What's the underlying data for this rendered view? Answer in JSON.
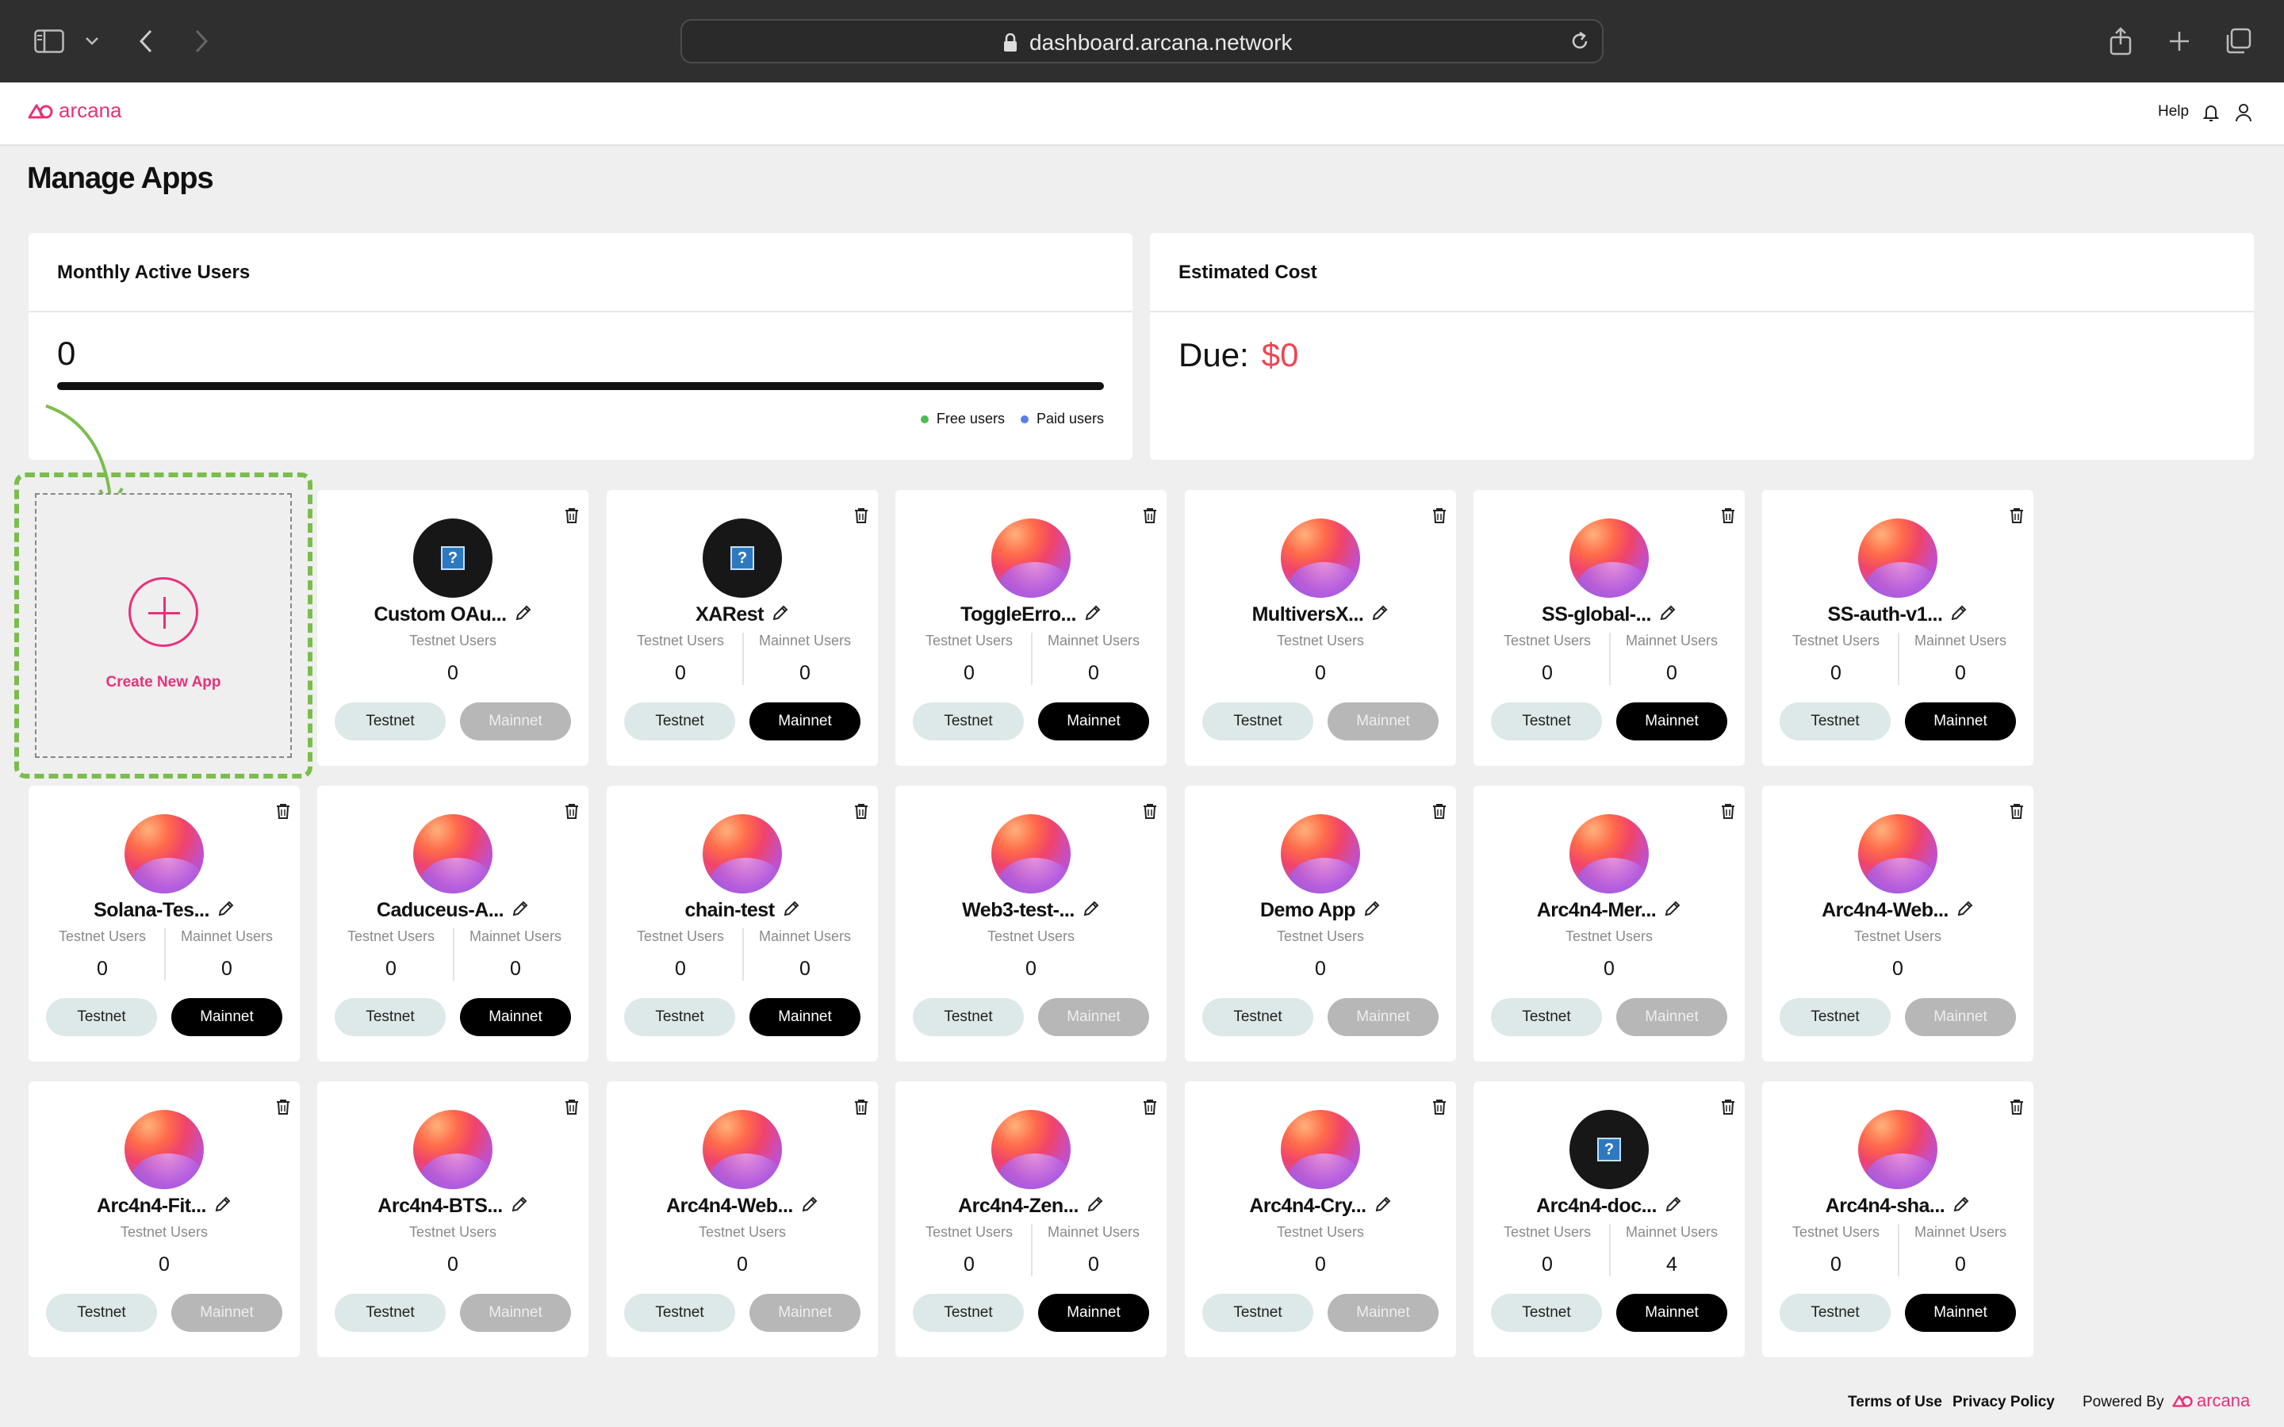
{
  "browser": {
    "url": "dashboard.arcana.network"
  },
  "header": {
    "logo_text": "arcana",
    "help": "Help"
  },
  "page_title": "Manage Apps",
  "mau": {
    "title": "Monthly Active Users",
    "value": "0",
    "legend_free": "Free users",
    "legend_paid": "Paid users",
    "free_color": "#4cbb5a",
    "paid_color": "#5b7de8"
  },
  "cost": {
    "title": "Estimated Cost",
    "due_label": "Due:",
    "due_value": "$0"
  },
  "create": {
    "label": "Create New App"
  },
  "labels": {
    "testnet_users": "Testnet Users",
    "mainnet_users": "Mainnet Users",
    "testnet": "Testnet",
    "mainnet": "Mainnet"
  },
  "apps": [
    {
      "name": "Custom OAu...",
      "avatar": "placeholder",
      "testnet": "0",
      "mainnet": null,
      "mainnet_active": false
    },
    {
      "name": "XARest",
      "avatar": "placeholder",
      "testnet": "0",
      "mainnet": "0",
      "mainnet_active": true
    },
    {
      "name": "ToggleErro...",
      "avatar": "gradient",
      "testnet": "0",
      "mainnet": "0",
      "mainnet_active": true
    },
    {
      "name": "MultiversX...",
      "avatar": "gradient",
      "testnet": "0",
      "mainnet": null,
      "mainnet_active": false
    },
    {
      "name": "SS-global-...",
      "avatar": "gradient",
      "testnet": "0",
      "mainnet": "0",
      "mainnet_active": true
    },
    {
      "name": "SS-auth-v1...",
      "avatar": "gradient",
      "testnet": "0",
      "mainnet": "0",
      "mainnet_active": true
    },
    {
      "name": "Solana-Tes...",
      "avatar": "gradient",
      "testnet": "0",
      "mainnet": "0",
      "mainnet_active": true
    },
    {
      "name": "Caduceus-A...",
      "avatar": "gradient",
      "testnet": "0",
      "mainnet": "0",
      "mainnet_active": true
    },
    {
      "name": "chain-test",
      "avatar": "gradient",
      "testnet": "0",
      "mainnet": "0",
      "mainnet_active": true
    },
    {
      "name": "Web3-test-...",
      "avatar": "gradient",
      "testnet": "0",
      "mainnet": null,
      "mainnet_active": false
    },
    {
      "name": "Demo App",
      "avatar": "gradient",
      "testnet": "0",
      "mainnet": null,
      "mainnet_active": false
    },
    {
      "name": "Arc4n4-Mer...",
      "avatar": "gradient",
      "testnet": "0",
      "mainnet": null,
      "mainnet_active": false
    },
    {
      "name": "Arc4n4-Web...",
      "avatar": "gradient",
      "testnet": "0",
      "mainnet": null,
      "mainnet_active": false
    },
    {
      "name": "Arc4n4-Fit...",
      "avatar": "gradient",
      "testnet": "0",
      "mainnet": null,
      "mainnet_active": false
    },
    {
      "name": "Arc4n4-BTS...",
      "avatar": "gradient",
      "testnet": "0",
      "mainnet": null,
      "mainnet_active": false
    },
    {
      "name": "Arc4n4-Web...",
      "avatar": "gradient",
      "testnet": "0",
      "mainnet": null,
      "mainnet_active": false
    },
    {
      "name": "Arc4n4-Zen...",
      "avatar": "gradient",
      "testnet": "0",
      "mainnet": "0",
      "mainnet_active": true
    },
    {
      "name": "Arc4n4-Cry...",
      "avatar": "gradient",
      "testnet": "0",
      "mainnet": null,
      "mainnet_active": false
    },
    {
      "name": "Arc4n4-doc...",
      "avatar": "placeholder",
      "testnet": "0",
      "mainnet": "4",
      "mainnet_active": true
    },
    {
      "name": "Arc4n4-sha...",
      "avatar": "gradient",
      "testnet": "0",
      "mainnet": "0",
      "mainnet_active": true
    }
  ],
  "footer": {
    "terms": "Terms of Use",
    "privacy": "Privacy Policy",
    "powered_by": "Powered By",
    "brand": "arcana"
  }
}
